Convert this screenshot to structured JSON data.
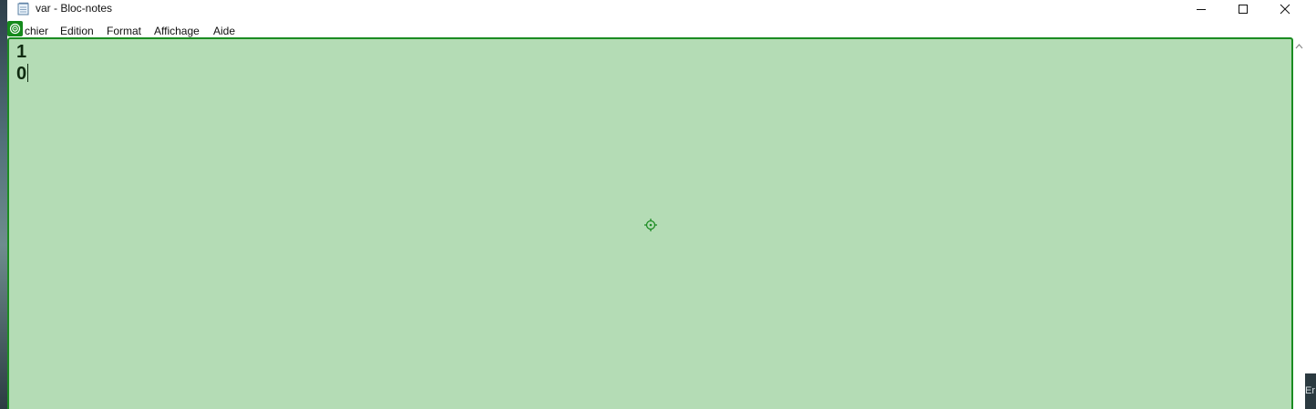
{
  "window": {
    "title": "var - Bloc-notes",
    "controls": {
      "minimize_icon": "minimize-icon",
      "maximize_icon": "maximize-icon",
      "close_icon": "close-icon"
    }
  },
  "menu": {
    "items": [
      {
        "label": "chier"
      },
      {
        "label": "Edition"
      },
      {
        "label": "Format"
      },
      {
        "label": "Affichage"
      },
      {
        "label": "Aide"
      }
    ]
  },
  "editor": {
    "lines": [
      "1",
      "0"
    ],
    "highlight_color": "#b4dcb5",
    "border_color": "#1b8c22"
  },
  "taskbar": {
    "fragment": "Er"
  }
}
